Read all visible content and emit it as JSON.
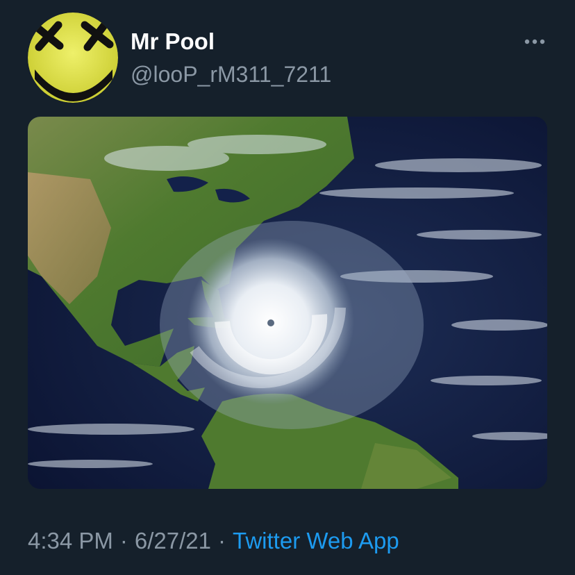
{
  "tweet": {
    "author": {
      "display_name": "Mr Pool",
      "handle": "@looP_rM311_7211",
      "avatar_icon": "yellow-smiley-avatar-with-crossed-out-eyes"
    },
    "more_icon": "more-horizontal-icon",
    "media": {
      "type": "satellite-image",
      "subject": "hurricane-over-caribbean"
    },
    "time": "4:34 PM",
    "separator": "·",
    "date": "6/27/21",
    "source": "Twitter Web App"
  },
  "colors": {
    "background": "#15202b",
    "text_primary": "#ffffff",
    "text_secondary": "#8b98a5",
    "link": "#1d9bf0",
    "avatar_yellow": "#e4e44a"
  }
}
